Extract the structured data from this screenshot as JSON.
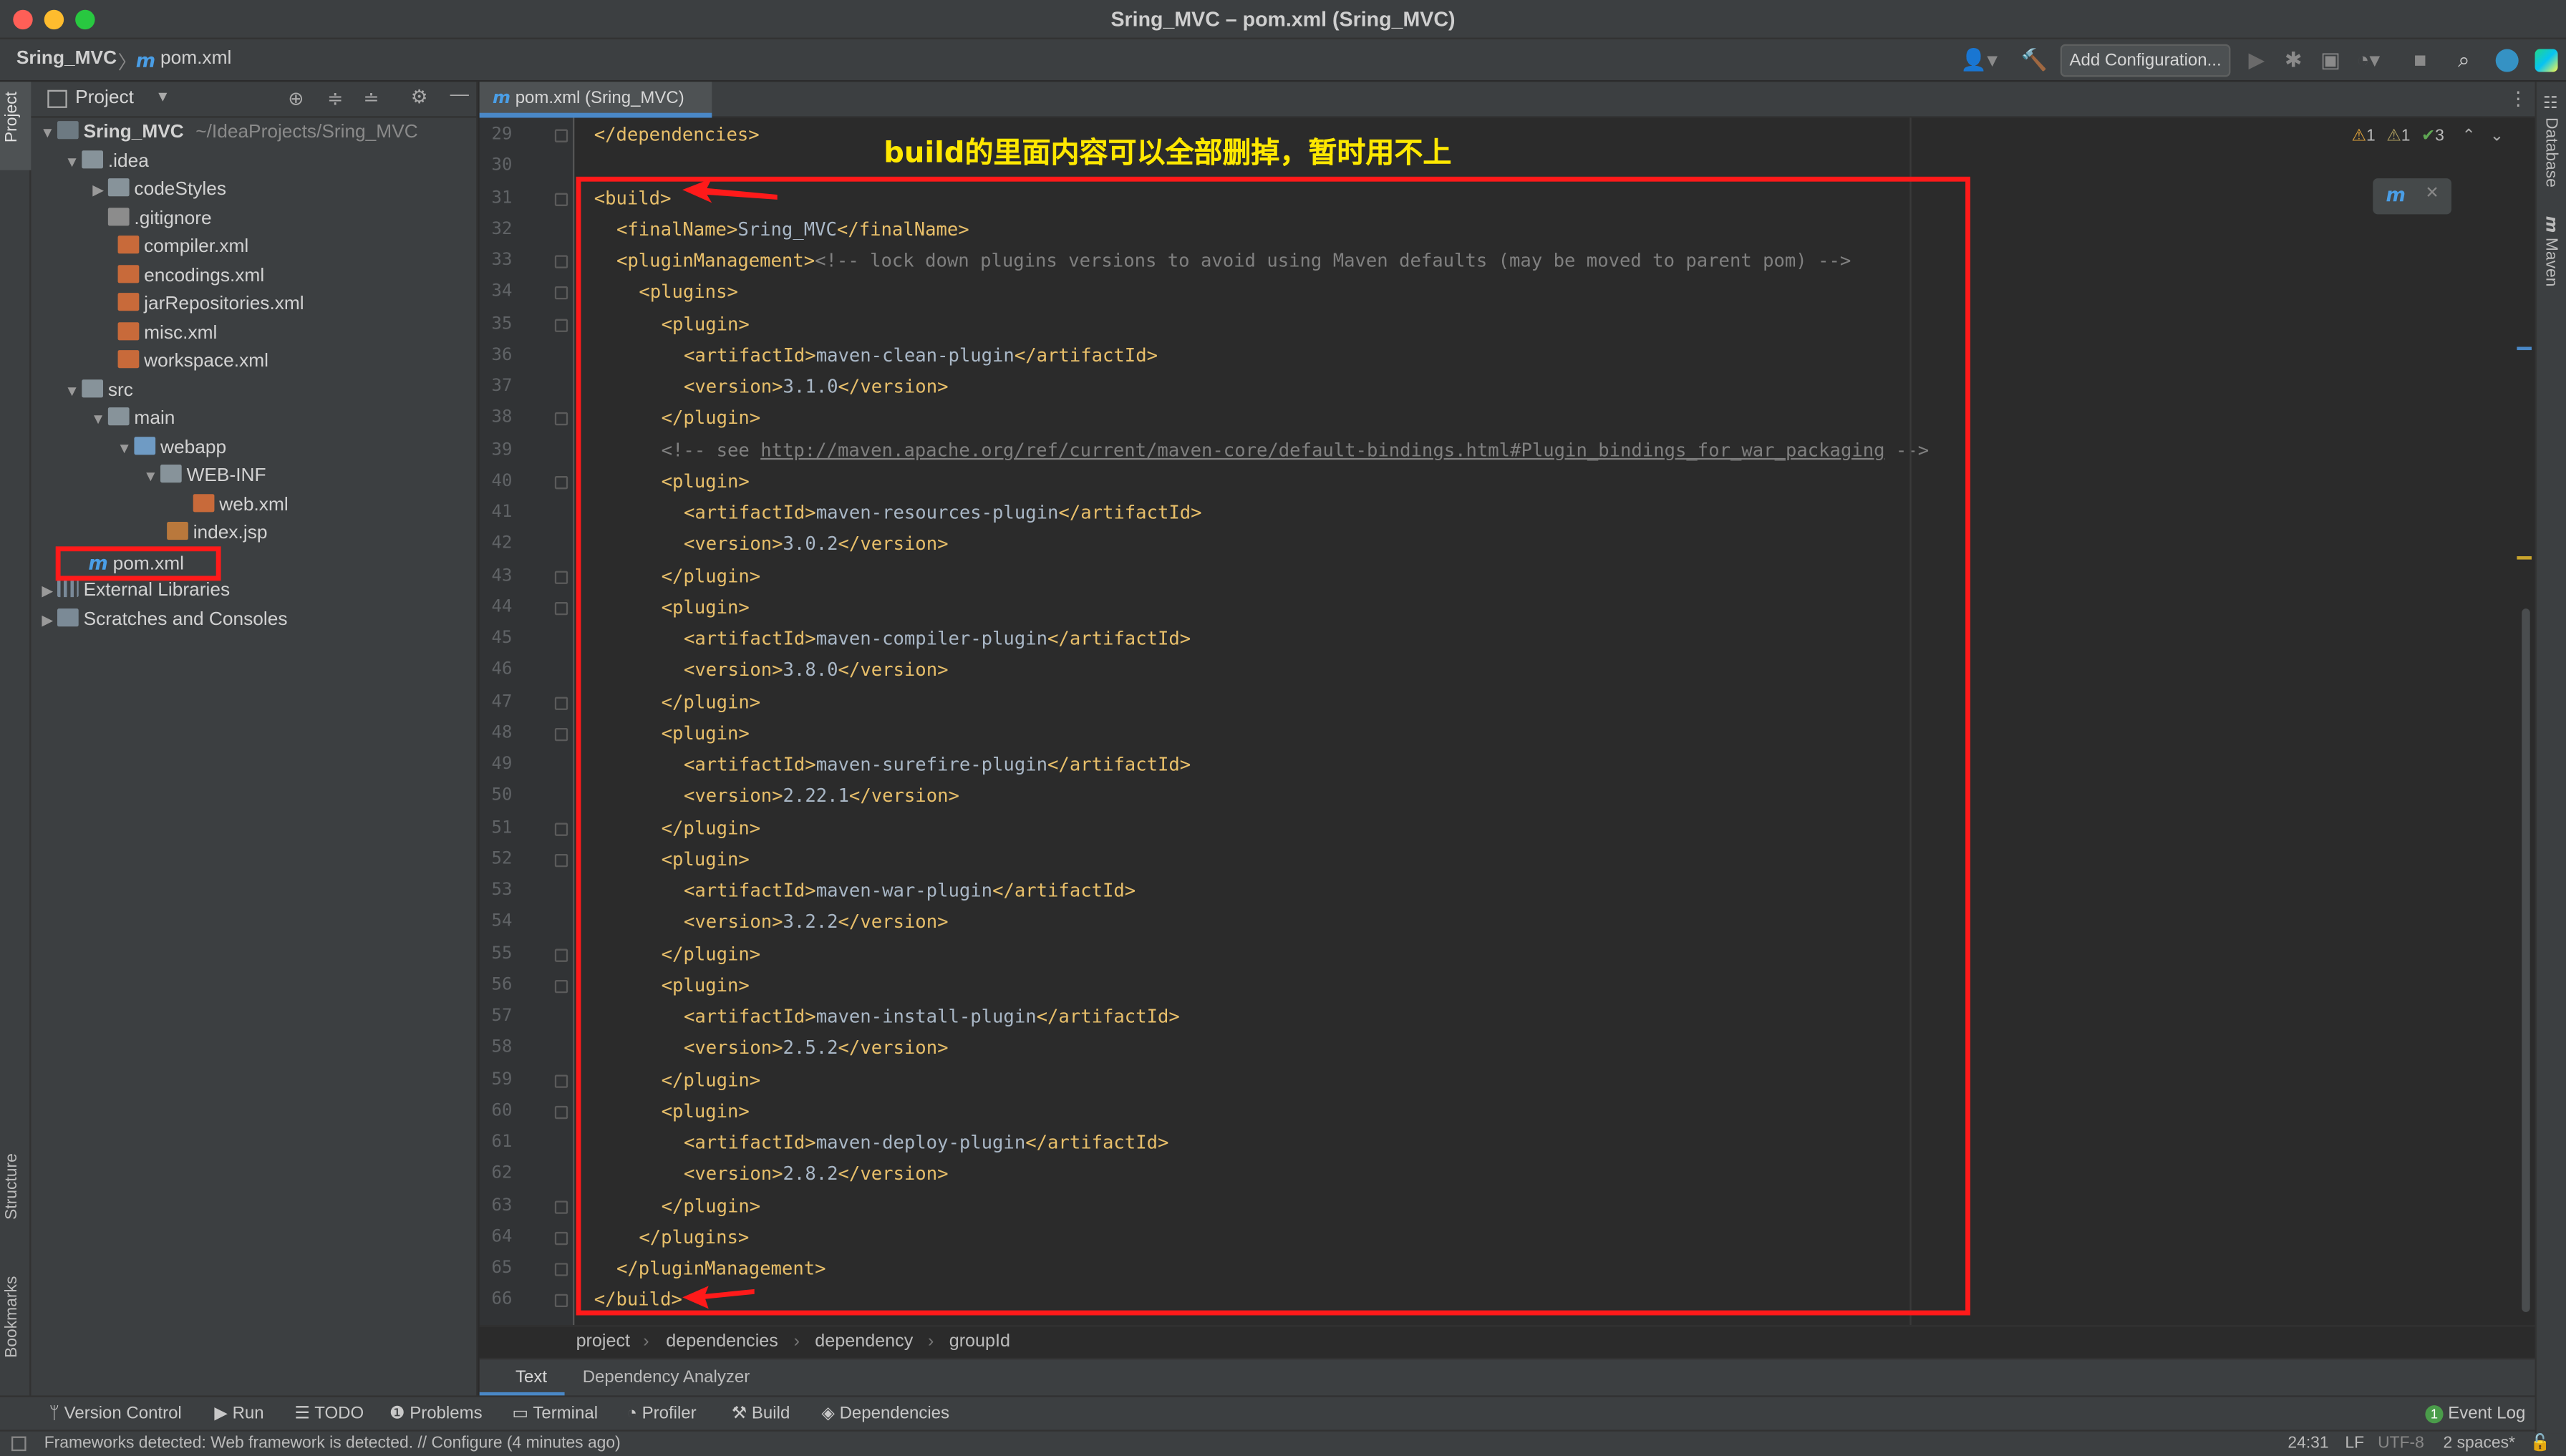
{
  "window": {
    "title": "Sring_MVC – pom.xml (Sring_MVC)"
  },
  "navbar": {
    "project": "Sring_MVC",
    "file": "pom.xml",
    "add_config": "Add Configuration..."
  },
  "project_panel": {
    "title": "Project",
    "root_name": "Sring_MVC",
    "root_path": "~/IdeaProjects/Sring_MVC",
    "tree": [
      ".idea",
      "codeStyles",
      ".gitignore",
      "compiler.xml",
      "encodings.xml",
      "jarRepositories.xml",
      "misc.xml",
      "workspace.xml",
      "src",
      "main",
      "webapp",
      "WEB-INF",
      "web.xml",
      "index.jsp",
      "pom.xml",
      "External Libraries",
      "Scratches and Consoles"
    ]
  },
  "side_tabs": {
    "project": "Project",
    "structure": "Structure",
    "bookmarks": "Bookmarks",
    "database": "Database",
    "maven": "Maven"
  },
  "editor": {
    "tab": "pom.xml (Sring_MVC)",
    "inspections": {
      "warn1": "1",
      "warn2": "1",
      "ok": "3"
    },
    "lines": [
      {
        "n": "29",
        "i": 1,
        "tokens": [
          {
            "t": "tg",
            "v": "</dependencies>"
          }
        ]
      },
      {
        "n": "30",
        "i": 0,
        "tokens": []
      },
      {
        "n": "31",
        "i": 1,
        "tokens": [
          {
            "t": "tg",
            "v": "<build>"
          }
        ]
      },
      {
        "n": "32",
        "i": 2,
        "tokens": [
          {
            "t": "tg",
            "v": "<finalName>"
          },
          {
            "t": "tx",
            "v": "Sring_MVC"
          },
          {
            "t": "tg",
            "v": "</finalName>"
          }
        ]
      },
      {
        "n": "33",
        "i": 2,
        "tokens": [
          {
            "t": "tg",
            "v": "<pluginManagement>"
          },
          {
            "t": "cm",
            "v": "<!-- lock down plugins versions to avoid using Maven defaults (may be moved to parent pom) -->"
          }
        ]
      },
      {
        "n": "34",
        "i": 3,
        "tokens": [
          {
            "t": "tg",
            "v": "<plugins>"
          }
        ]
      },
      {
        "n": "35",
        "i": 4,
        "tokens": [
          {
            "t": "tg",
            "v": "<plugin>"
          }
        ]
      },
      {
        "n": "36",
        "i": 5,
        "tokens": [
          {
            "t": "tg",
            "v": "<artifactId>"
          },
          {
            "t": "tx",
            "v": "maven-clean-plugin"
          },
          {
            "t": "tg",
            "v": "</artifactId>"
          }
        ]
      },
      {
        "n": "37",
        "i": 5,
        "tokens": [
          {
            "t": "tg",
            "v": "<version>"
          },
          {
            "t": "tx",
            "v": "3.1.0"
          },
          {
            "t": "tg",
            "v": "</version>"
          }
        ]
      },
      {
        "n": "38",
        "i": 4,
        "tokens": [
          {
            "t": "tg",
            "v": "</plugin>"
          }
        ]
      },
      {
        "n": "39",
        "i": 4,
        "tokens": [
          {
            "t": "cm",
            "v": "<!-- see "
          },
          {
            "t": "ln",
            "v": "http://maven.apache.org/ref/current/maven-core/default-bindings.html#Plugin_bindings_for_war_packaging"
          },
          {
            "t": "cm",
            "v": " -->"
          }
        ]
      },
      {
        "n": "40",
        "i": 4,
        "tokens": [
          {
            "t": "tg",
            "v": "<plugin>"
          }
        ]
      },
      {
        "n": "41",
        "i": 5,
        "tokens": [
          {
            "t": "tg",
            "v": "<artifactId>"
          },
          {
            "t": "tx",
            "v": "maven-resources-plugin"
          },
          {
            "t": "tg",
            "v": "</artifactId>"
          }
        ]
      },
      {
        "n": "42",
        "i": 5,
        "tokens": [
          {
            "t": "tg",
            "v": "<version>"
          },
          {
            "t": "tx",
            "v": "3.0.2"
          },
          {
            "t": "tg",
            "v": "</version>"
          }
        ]
      },
      {
        "n": "43",
        "i": 4,
        "tokens": [
          {
            "t": "tg",
            "v": "</plugin>"
          }
        ]
      },
      {
        "n": "44",
        "i": 4,
        "tokens": [
          {
            "t": "tg",
            "v": "<plugin>"
          }
        ]
      },
      {
        "n": "45",
        "i": 5,
        "tokens": [
          {
            "t": "tg",
            "v": "<artifactId>"
          },
          {
            "t": "tx",
            "v": "maven-compiler-plugin"
          },
          {
            "t": "tg",
            "v": "</artifactId>"
          }
        ]
      },
      {
        "n": "46",
        "i": 5,
        "tokens": [
          {
            "t": "tg",
            "v": "<version>"
          },
          {
            "t": "tx",
            "v": "3.8.0"
          },
          {
            "t": "tg",
            "v": "</version>"
          }
        ]
      },
      {
        "n": "47",
        "i": 4,
        "tokens": [
          {
            "t": "tg",
            "v": "</plugin>"
          }
        ]
      },
      {
        "n": "48",
        "i": 4,
        "tokens": [
          {
            "t": "tg",
            "v": "<plugin>"
          }
        ]
      },
      {
        "n": "49",
        "i": 5,
        "tokens": [
          {
            "t": "tg",
            "v": "<artifactId>"
          },
          {
            "t": "tx",
            "v": "maven-surefire-plugin"
          },
          {
            "t": "tg",
            "v": "</artifactId>"
          }
        ]
      },
      {
        "n": "50",
        "i": 5,
        "tokens": [
          {
            "t": "tg",
            "v": "<version>"
          },
          {
            "t": "tx",
            "v": "2.22.1"
          },
          {
            "t": "tg",
            "v": "</version>"
          }
        ]
      },
      {
        "n": "51",
        "i": 4,
        "tokens": [
          {
            "t": "tg",
            "v": "</plugin>"
          }
        ]
      },
      {
        "n": "52",
        "i": 4,
        "tokens": [
          {
            "t": "tg",
            "v": "<plugin>"
          }
        ]
      },
      {
        "n": "53",
        "i": 5,
        "tokens": [
          {
            "t": "tg",
            "v": "<artifactId>"
          },
          {
            "t": "tx",
            "v": "maven-war-plugin"
          },
          {
            "t": "tg",
            "v": "</artifactId>"
          }
        ]
      },
      {
        "n": "54",
        "i": 5,
        "tokens": [
          {
            "t": "tg",
            "v": "<version>"
          },
          {
            "t": "tx",
            "v": "3.2.2"
          },
          {
            "t": "tg",
            "v": "</version>"
          }
        ]
      },
      {
        "n": "55",
        "i": 4,
        "tokens": [
          {
            "t": "tg",
            "v": "</plugin>"
          }
        ]
      },
      {
        "n": "56",
        "i": 4,
        "tokens": [
          {
            "t": "tg",
            "v": "<plugin>"
          }
        ]
      },
      {
        "n": "57",
        "i": 5,
        "tokens": [
          {
            "t": "tg",
            "v": "<artifactId>"
          },
          {
            "t": "tx",
            "v": "maven-install-plugin"
          },
          {
            "t": "tg",
            "v": "</artifactId>"
          }
        ]
      },
      {
        "n": "58",
        "i": 5,
        "tokens": [
          {
            "t": "tg",
            "v": "<version>"
          },
          {
            "t": "tx",
            "v": "2.5.2"
          },
          {
            "t": "tg",
            "v": "</version>"
          }
        ]
      },
      {
        "n": "59",
        "i": 4,
        "tokens": [
          {
            "t": "tg",
            "v": "</plugin>"
          }
        ]
      },
      {
        "n": "60",
        "i": 4,
        "tokens": [
          {
            "t": "tg",
            "v": "<plugin>"
          }
        ]
      },
      {
        "n": "61",
        "i": 5,
        "tokens": [
          {
            "t": "tg",
            "v": "<artifactId>"
          },
          {
            "t": "tx",
            "v": "maven-deploy-plugin"
          },
          {
            "t": "tg",
            "v": "</artifactId>"
          }
        ]
      },
      {
        "n": "62",
        "i": 5,
        "tokens": [
          {
            "t": "tg",
            "v": "<version>"
          },
          {
            "t": "tx",
            "v": "2.8.2"
          },
          {
            "t": "tg",
            "v": "</version>"
          }
        ]
      },
      {
        "n": "63",
        "i": 4,
        "tokens": [
          {
            "t": "tg",
            "v": "</plugin>"
          }
        ]
      },
      {
        "n": "64",
        "i": 3,
        "tokens": [
          {
            "t": "tg",
            "v": "</plugins>"
          }
        ]
      },
      {
        "n": "65",
        "i": 2,
        "tokens": [
          {
            "t": "tg",
            "v": "</pluginManagement>"
          }
        ]
      },
      {
        "n": "66",
        "i": 1,
        "tokens": [
          {
            "t": "tg",
            "v": "</build>"
          }
        ]
      }
    ]
  },
  "annotation": {
    "text": "build的里面内容可以全部删掉，暂时用不上",
    "color": "#ffe800",
    "box_color": "#ff1a1a"
  },
  "breadcrumb": [
    "project",
    "dependencies",
    "dependency",
    "groupId"
  ],
  "editor_bottom_tabs": [
    "Text",
    "Dependency Analyzer"
  ],
  "tool_windows": {
    "version_control": "Version Control",
    "run": "Run",
    "todo": "TODO",
    "problems": "Problems",
    "terminal": "Terminal",
    "profiler": "Profiler",
    "build": "Build",
    "dependencies": "Dependencies",
    "event_log": "Event Log",
    "event_count": "1"
  },
  "status": {
    "message": "Frameworks detected: Web framework is detected. // Configure (4 minutes ago)",
    "position": "24:31",
    "line_sep": "LF",
    "encoding": "UTF-8",
    "indent": "2 spaces*"
  },
  "colors": {
    "tag": "#e8bf6a",
    "text": "#a9b7c6",
    "comment": "#808080",
    "accent": "#4a88c7"
  }
}
